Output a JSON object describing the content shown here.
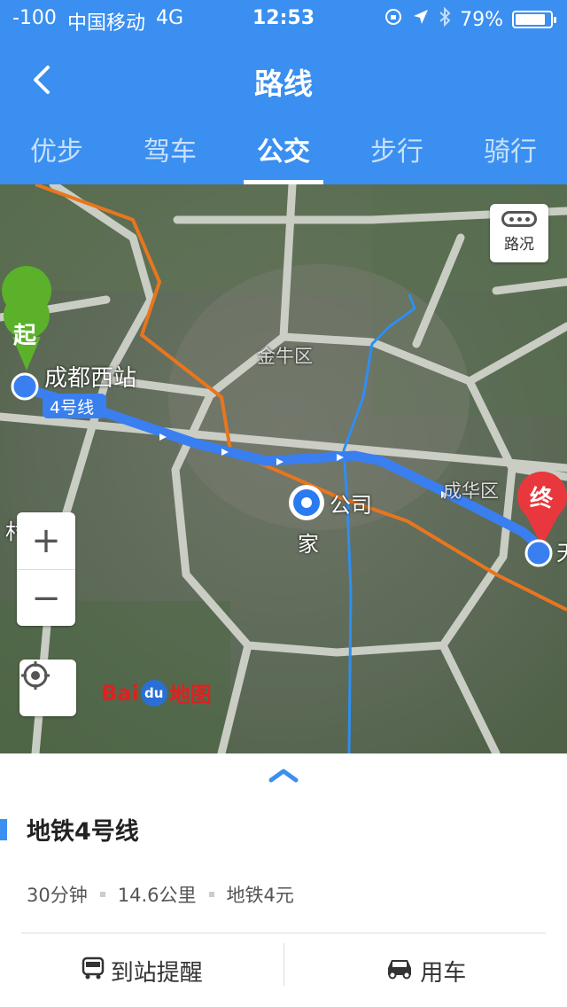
{
  "status": {
    "signal": "-100",
    "carrier": "中国移动",
    "network": "4G",
    "time": "12:53",
    "battery_pct": "79%"
  },
  "header": {
    "title": "路线"
  },
  "tabs": [
    {
      "label": "优步"
    },
    {
      "label": "驾车"
    },
    {
      "label": "公交"
    },
    {
      "label": "步行"
    },
    {
      "label": "骑行"
    }
  ],
  "map": {
    "traffic_label": "路况",
    "start_badge": "起",
    "end_badge": "终",
    "start_station": "成都西站",
    "line_tag": "4号线",
    "district_1": "金牛区",
    "district_2": "成华区",
    "poi_company": "公司",
    "poi_home": "家",
    "zoom_in": "+",
    "zoom_out": "−",
    "logo_bai": "Bai",
    "logo_du": "du",
    "logo_map": "地图",
    "left_edge_label": "村",
    "right_edge_label": "天",
    "accent_route": "#3a7ff0",
    "accent_start": "#5bb12a",
    "accent_end": "#e8383d"
  },
  "panel": {
    "route_name": "地铁4号线",
    "duration": "30分钟",
    "distance": "14.6公里",
    "fare": "地铁4元",
    "alert_label": "到站提醒",
    "car_label": "用车"
  }
}
